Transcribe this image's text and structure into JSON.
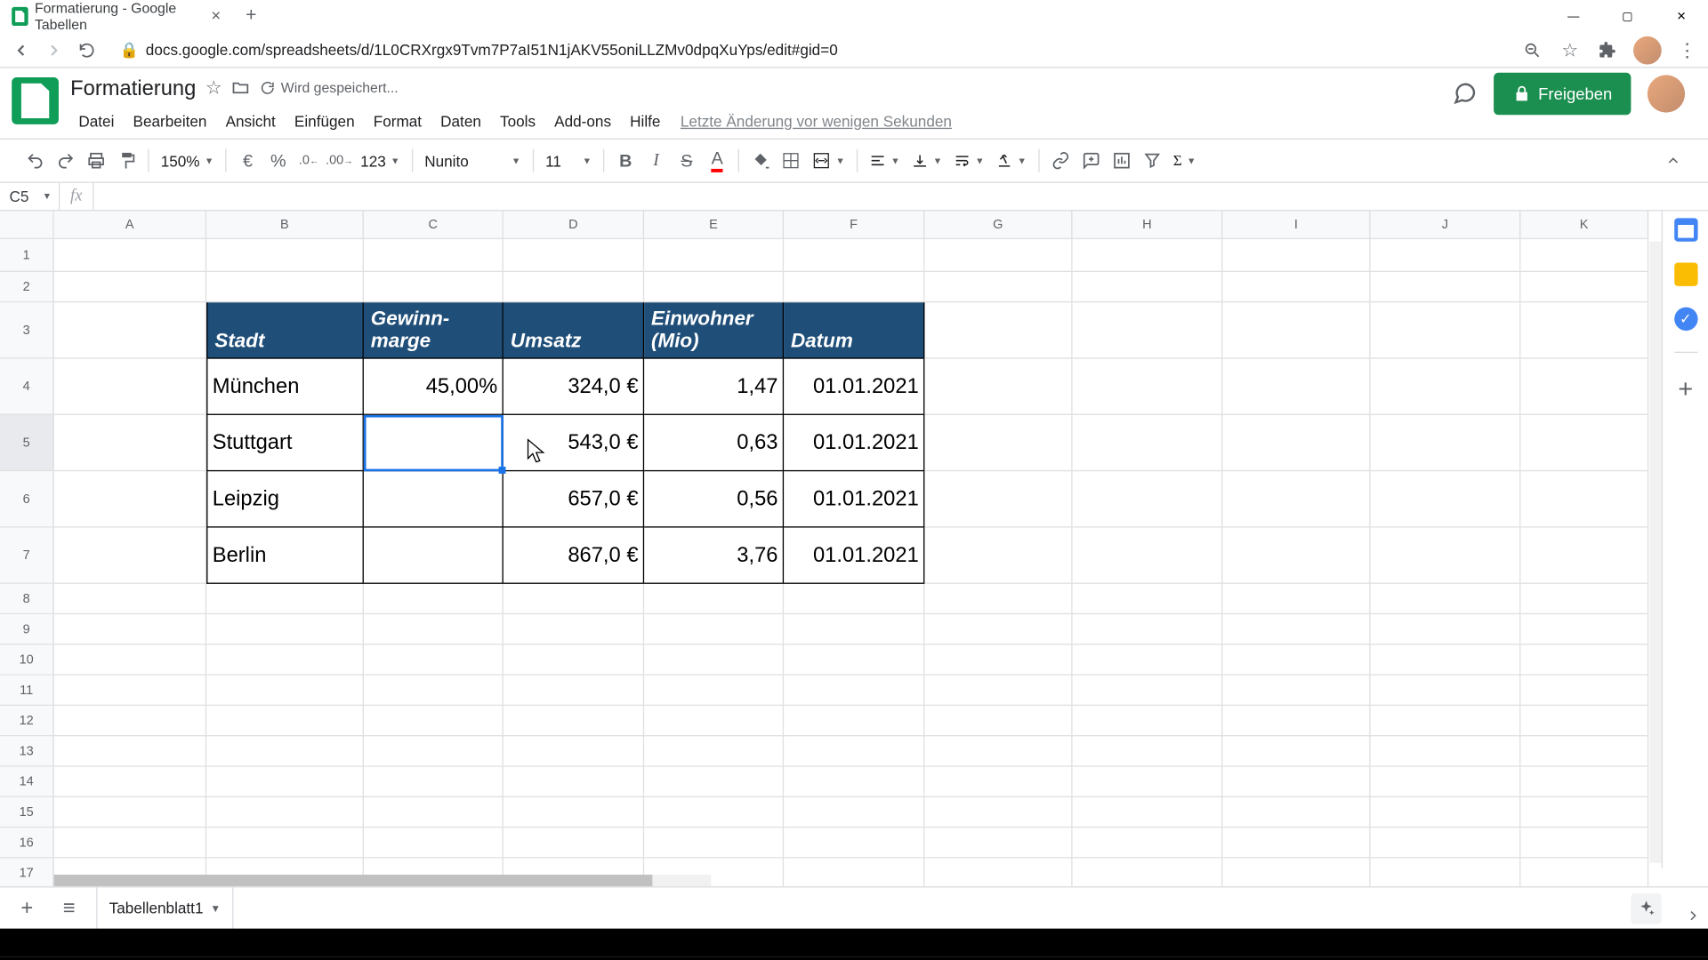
{
  "browser": {
    "tab_title": "Formatierung - Google Tabellen",
    "url": "docs.google.com/spreadsheets/d/1L0CRXrgx9Tvm7P7aI51N1jAKV55oniLLZMv0dpqXuYps/edit#gid=0"
  },
  "doc": {
    "title": "Formatierung",
    "saving_status": "Wird gespeichert...",
    "last_edit": "Letzte Änderung vor wenigen Sekunden",
    "share_label": "Freigeben"
  },
  "menus": {
    "file": "Datei",
    "edit": "Bearbeiten",
    "view": "Ansicht",
    "insert": "Einfügen",
    "format": "Format",
    "data": "Daten",
    "tools": "Tools",
    "addons": "Add-ons",
    "help": "Hilfe"
  },
  "toolbar": {
    "zoom": "150%",
    "currency": "€",
    "percent": "%",
    "dec_dec": ".0",
    "inc_dec": ".00",
    "num_format": "123",
    "font": "Nunito",
    "font_size": "11"
  },
  "namebox": "C5",
  "columns": [
    "A",
    "B",
    "C",
    "D",
    "E",
    "F",
    "G",
    "H",
    "I",
    "J",
    "K"
  ],
  "row_count": 17,
  "table": {
    "headers": {
      "stadt": "Stadt",
      "gewinnmarge": "Gewinn-\nmarge",
      "umsatz": "Umsatz",
      "einwohner": "Einwohner (Mio)",
      "datum": "Datum"
    },
    "rows": [
      {
        "stadt": "München",
        "marge": "45,00%",
        "umsatz": "324,0 €",
        "einwohner": "1,47",
        "datum": "01.01.2021"
      },
      {
        "stadt": "Stuttgart",
        "marge": "",
        "umsatz": "543,0 €",
        "einwohner": "0,63",
        "datum": "01.01.2021"
      },
      {
        "stadt": "Leipzig",
        "marge": "",
        "umsatz": "657,0 €",
        "einwohner": "0,56",
        "datum": "01.01.2021"
      },
      {
        "stadt": "Berlin",
        "marge": "",
        "umsatz": "867,0 €",
        "einwohner": "3,76",
        "datum": "01.01.2021"
      }
    ]
  },
  "footer": {
    "sheet_tab": "Tabellenblatt1"
  }
}
